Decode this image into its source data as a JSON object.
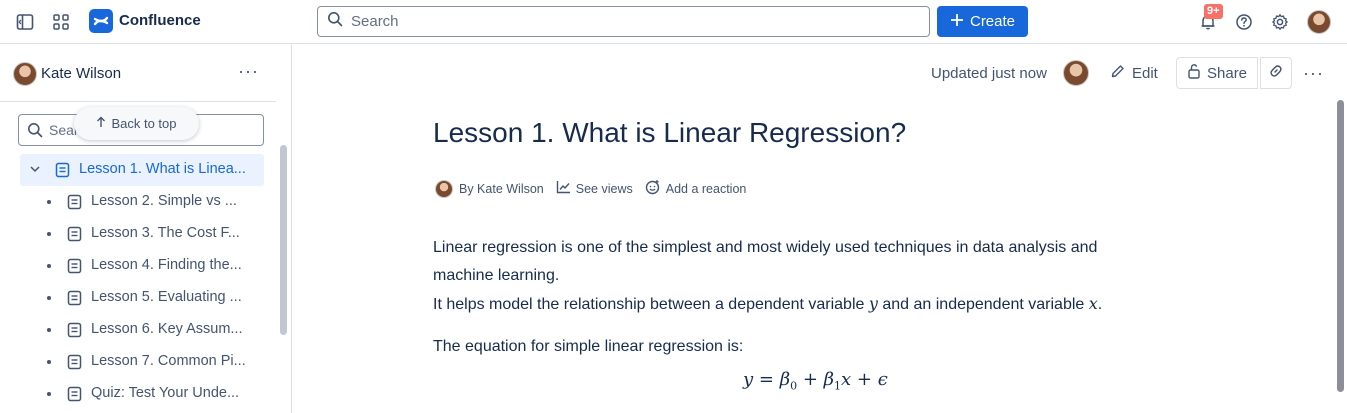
{
  "topbar": {
    "brand": "Confluence",
    "search_placeholder": "Search",
    "create_label": "Create",
    "notification_badge": "9+"
  },
  "sidebar": {
    "user_name": "Kate Wilson",
    "more_label": "···",
    "search_placeholder": "Sear",
    "back_to_top": "Back to top",
    "items": [
      {
        "label": "Lesson 1. What is Linea..."
      },
      {
        "label": "Lesson 2. Simple vs ..."
      },
      {
        "label": "Lesson 3. The Cost F..."
      },
      {
        "label": "Lesson 4. Finding the..."
      },
      {
        "label": "Lesson 5. Evaluating ..."
      },
      {
        "label": "Lesson 6. Key Assum..."
      },
      {
        "label": "Lesson 7. Common Pi..."
      },
      {
        "label": "Quiz: Test Your Unde..."
      }
    ]
  },
  "page": {
    "updated": "Updated just now",
    "edit_label": "Edit",
    "share_label": "Share",
    "title": "Lesson 1. What is Linear Regression?",
    "byline_author": "By Kate Wilson",
    "see_views": "See views",
    "add_reaction": "Add a reaction",
    "para1_line1": "Linear regression is one of the simplest and most widely used techniques in data analysis and",
    "para1_line2": "machine learning.",
    "para2_a": "It helps model the relationship between a dependent variable ",
    "para2_var_y": "y",
    "para2_b": " and an independent variable ",
    "para2_var_x": "x",
    "para2_c": ".",
    "para3": "The equation for simple linear regression is:",
    "equation": {
      "lhs": "y",
      "eq": " = ",
      "beta": "β",
      "sub0": "0",
      "plus1": " + ",
      "sub1": "1",
      "x": "x",
      "plus2": " + ",
      "eps": "ϵ"
    }
  },
  "colors": {
    "accent": "#1868db",
    "active_bg": "#e9f2fe",
    "badge": "#f87168",
    "text": "#172b4d",
    "subtle": "#44546f"
  }
}
